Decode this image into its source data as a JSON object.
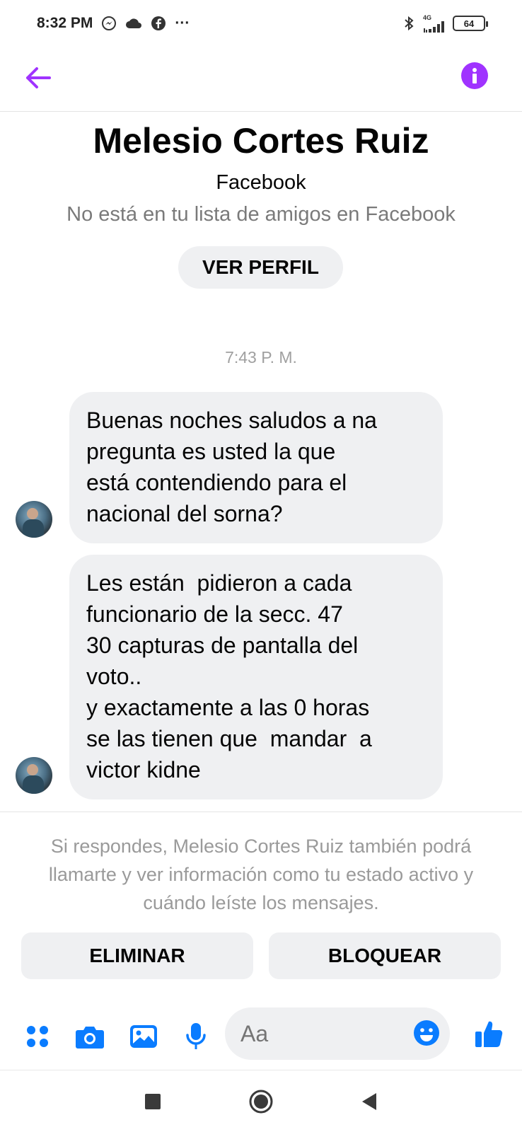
{
  "status_bar": {
    "time": "8:32 PM",
    "network_label": "4G",
    "battery": "64",
    "more": "···"
  },
  "profile": {
    "name": "Melesio Cortes Ruiz",
    "source": "Facebook",
    "note": "No está en tu lista de amigos en Facebook",
    "view_profile_label": "VER PERFIL"
  },
  "conversation": {
    "timestamp": "7:43 P. M.",
    "messages": [
      {
        "lines": [
          "Buenas noches saludos a na",
          "pregunta es usted la que",
          "está contendiendo para el",
          "nacional del sorna?"
        ]
      },
      {
        "lines": [
          "Les están  pidieron a cada",
          "funcionario de la secc. 47",
          "30 capturas de pantalla del",
          "voto..",
          "y exactamente a las 0 horas",
          "se las tienen que  mandar  a",
          "victor kidne"
        ]
      }
    ]
  },
  "request": {
    "notice": "Si respondes, Melesio Cortes Ruiz también podrá llamarte y ver información como tu estado activo y cuándo leíste los mensajes.",
    "delete_label": "ELIMINAR",
    "block_label": "BLOQUEAR"
  },
  "composer": {
    "placeholder": "Aa",
    "icons": [
      "apps-icon",
      "camera-icon",
      "gallery-icon",
      "microphone-icon",
      "emoji-icon",
      "thumbs-up-icon"
    ]
  },
  "colors": {
    "accent_purple": "#a033ff",
    "messenger_blue": "#0a7cff",
    "bubble_gray": "#eff0f2"
  }
}
